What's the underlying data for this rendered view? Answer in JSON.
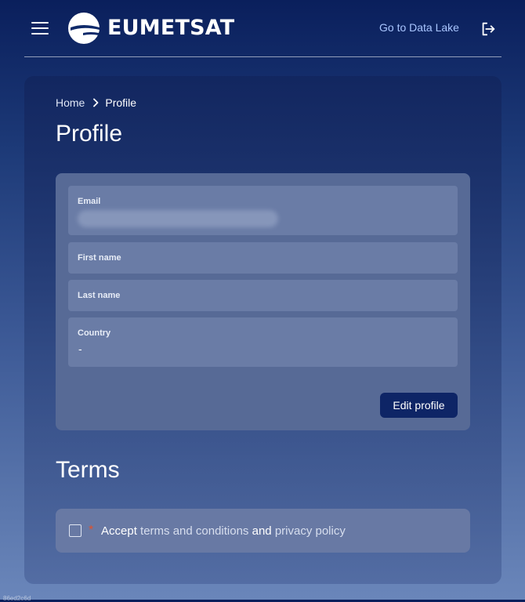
{
  "header": {
    "logo_text": "EUMETSAT",
    "datalake_label": "Go to Data Lake"
  },
  "breadcrumb": {
    "home": "Home",
    "current": "Profile"
  },
  "page": {
    "title": "Profile"
  },
  "form": {
    "email_label": "Email",
    "first_name_label": "First name",
    "last_name_label": "Last name",
    "country_label": "Country",
    "country_value": "-",
    "edit_label": "Edit profile"
  },
  "terms": {
    "title": "Terms",
    "required_mark": "*",
    "accept": "Accept",
    "terms_link": "terms and conditions",
    "and": "and",
    "privacy_link": "privacy policy",
    "accepted": false
  },
  "footer": {
    "hash": "86ed2c6d"
  },
  "colors": {
    "bg_top": "#0a1f5c",
    "bg_bottom": "#6a86ba",
    "primary_button": "#0e2566",
    "link": "#a9c6ff",
    "required": "#e0512a"
  },
  "icons": [
    "hamburger-menu-icon",
    "eumetsat-logo-icon",
    "logout-icon",
    "chevron-right-icon",
    "checkbox-icon"
  ]
}
